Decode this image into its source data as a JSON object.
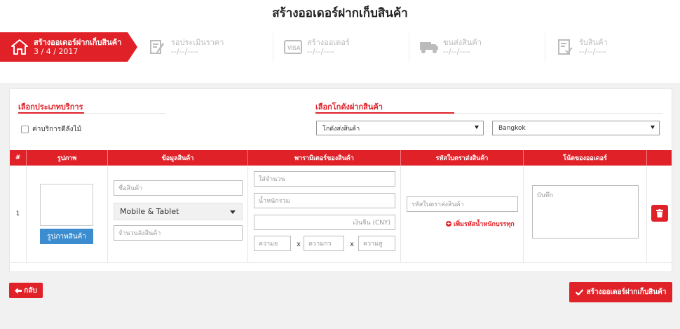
{
  "page": {
    "title": "สร้างออเดอร์ฝากเก็บสินค้า"
  },
  "steps": [
    {
      "name": "สร้างออเดอร์ฝากเก็บสินค้า",
      "date": "3 / 4 / 2017",
      "icon": "home-icon",
      "active": true
    },
    {
      "name": "รอประเมินราคา",
      "date": "--/--/----",
      "icon": "edit-form-icon",
      "active": false
    },
    {
      "name": "สร้างออเดอร์",
      "date": "--/--/----",
      "icon": "visa-card-icon",
      "active": false
    },
    {
      "name": "ขนส่งสินค้า",
      "date": "--/--/----",
      "icon": "truck-icon",
      "active": false
    },
    {
      "name": "รับสินค้า",
      "date": "--/--/----",
      "icon": "checklist-icon",
      "active": false
    }
  ],
  "service": {
    "heading": "เลือกประเภทบริการ",
    "checkbox_label": "ค่าบริการตีลังไม้"
  },
  "warehouse": {
    "heading": "เลือกโกดังฝากสินค้า",
    "select_warehouse": "โกดังส่งสินค้า",
    "select_city": "Bangkok"
  },
  "table": {
    "headers": [
      "#",
      "รูปภาพ",
      "ข้อมูลสินค้า",
      "พารามิเตอร์ของสินค้า",
      "รหัสใบตราส่งสินค้า",
      "โน้ตของออเดอร์"
    ],
    "row": {
      "index": "1",
      "image_button": "รูปภาพสินค้า",
      "product_name_placeholder": "ชื่อสินค้า",
      "category": "Mobile & Tablet",
      "quantity_placeholder": "จำนวนลังสินค้า",
      "amount_placeholder": "ใส่จำนวน",
      "weight_placeholder": "น้ำหนักรวม",
      "price_placeholder": "เงินจีน (CNY)",
      "width_placeholder": "ความย",
      "length_placeholder": "ความกว",
      "height_placeholder": "ความสู",
      "dim_separator": "x",
      "tracking_placeholder": "รหัสใบตราส่งสินค้า",
      "add_tracking": "เพิ่มรหัสน้ำหนักบรรทุก",
      "note_placeholder": "บันทึก"
    }
  },
  "actions": {
    "back": "กลับ",
    "create": "สร้างออเดอร์ฝากเก็บสินค้า"
  },
  "colors": {
    "accent": "#e02128",
    "blue": "#3b8dd0"
  }
}
